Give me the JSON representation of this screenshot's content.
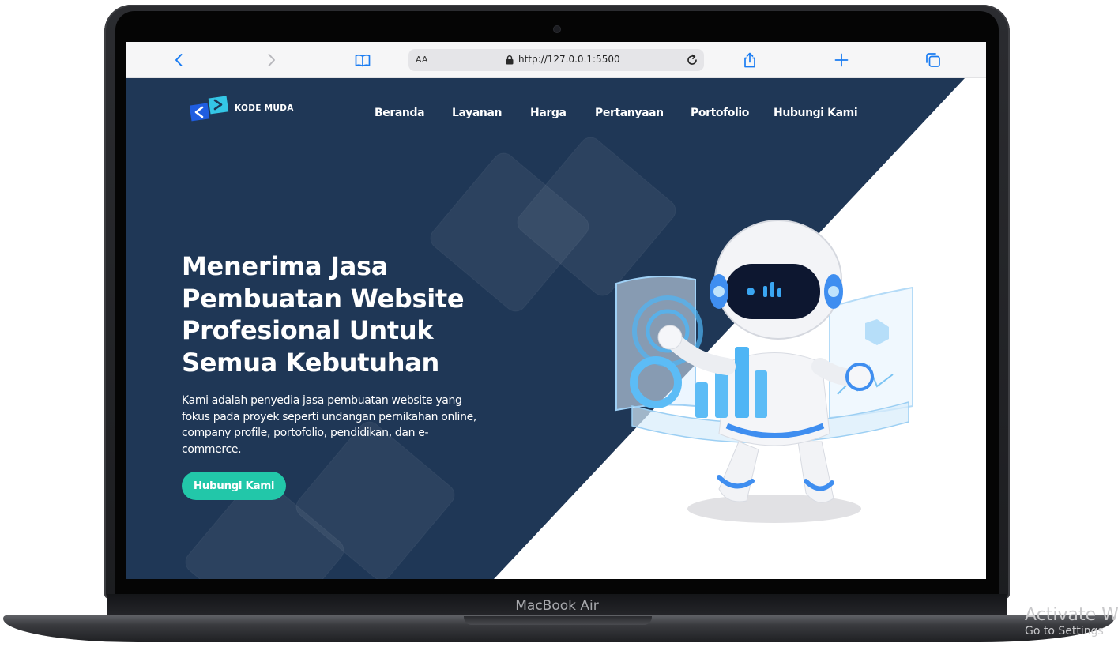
{
  "device": {
    "label": "MacBook Air"
  },
  "browser": {
    "text_size_label": "AA",
    "url": "http://127.0.0.1:5500",
    "icons": [
      "chevron-left-icon",
      "chevron-right-icon",
      "bookmarks-icon",
      "lock-icon",
      "reload-icon",
      "share-icon",
      "plus-icon",
      "tabs-icon"
    ]
  },
  "site": {
    "brand": "KODE MUDA",
    "nav": [
      {
        "label": "Beranda"
      },
      {
        "label": "Layanan"
      },
      {
        "label": "Harga"
      },
      {
        "label": "Pertanyaan"
      },
      {
        "label": "Portofolio"
      },
      {
        "label": "Hubungi Kami"
      }
    ],
    "hero": {
      "title_lines": [
        "Menerima Jasa",
        "Pembuatan Website",
        "Profesional Untuk",
        "Semua Kebutuhan"
      ],
      "description_lines": [
        "Kami adalah penyedia jasa pembuatan website yang",
        "fokus pada proyek seperti undangan pernikahan online,",
        "company profile, portofolio, pendidikan, dan e-",
        "commerce."
      ],
      "cta_label": "Hubungi Kami"
    },
    "colors": {
      "navy": "#1f3756",
      "teal_button": "#22c7a9",
      "logo_blue": "#1f5de0",
      "logo_cyan": "#34c6e6"
    }
  },
  "watermark": {
    "line1": "Activate W",
    "line2": "Go to Settings"
  }
}
